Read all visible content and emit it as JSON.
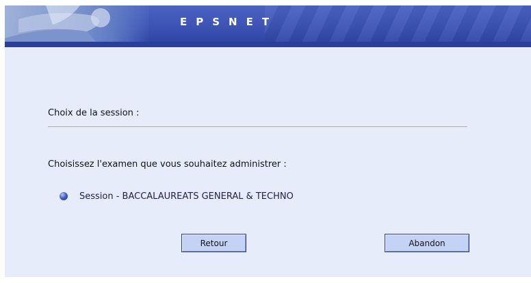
{
  "header": {
    "title": "EPSNET"
  },
  "session_section": {
    "title": "Choix de la session :",
    "prompt": "Choisissez l'examen que vous souhaitez administrer :",
    "sessions": [
      {
        "label": "Session - BACCALAUREATS GENERAL & TECHNO",
        "icon": "bullet-sphere-icon"
      }
    ]
  },
  "buttons": {
    "back_label": "Retour",
    "abort_label": "Abandon"
  },
  "colors": {
    "banner": "#3b52b3",
    "background": "#e7ecfa",
    "button": "#c4d3f5"
  }
}
